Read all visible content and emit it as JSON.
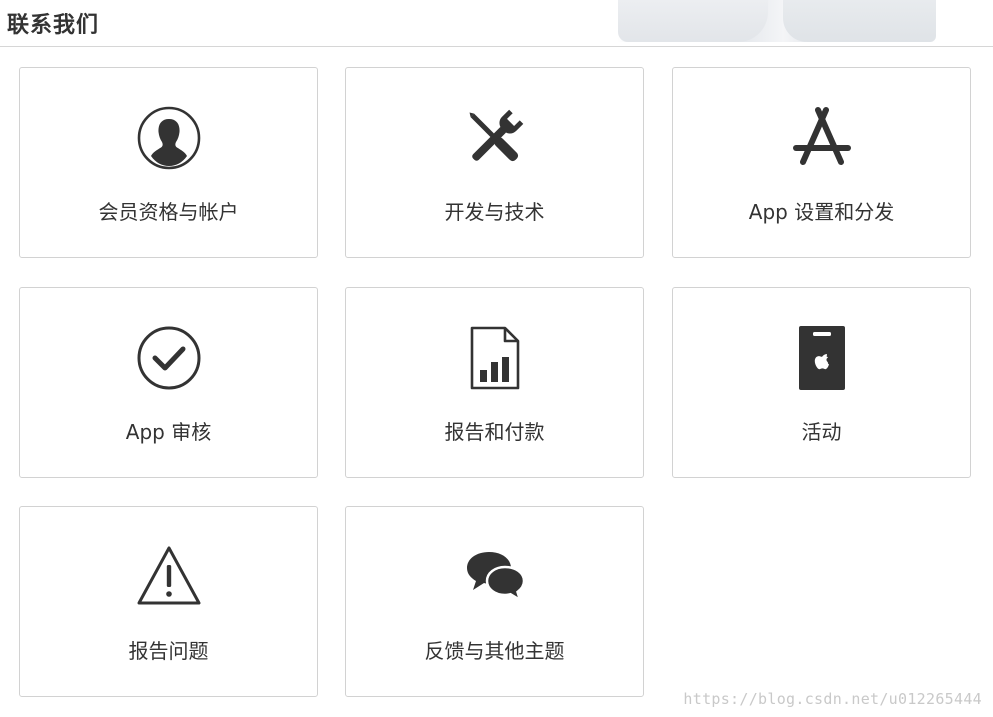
{
  "header": {
    "title": "联系我们"
  },
  "cards": [
    {
      "label": "会员资格与帐户",
      "icon": "person-icon"
    },
    {
      "label": "开发与技术",
      "icon": "tools-icon"
    },
    {
      "label": "App 设置和分发",
      "icon": "app-store-icon"
    },
    {
      "label": "App 审核",
      "icon": "checkmark-circle-icon"
    },
    {
      "label": "报告和付款",
      "icon": "report-chart-icon"
    },
    {
      "label": "活动",
      "icon": "event-badge-icon"
    },
    {
      "label": "报告问题",
      "icon": "warning-icon"
    },
    {
      "label": "反馈与其他主题",
      "icon": "chat-bubbles-icon"
    }
  ],
  "watermark": "https://blog.csdn.net/u012265444",
  "colors": {
    "text": "#333333",
    "border": "#d2d2d2",
    "icon": "#333333",
    "watermark": "#c9c9c9"
  }
}
